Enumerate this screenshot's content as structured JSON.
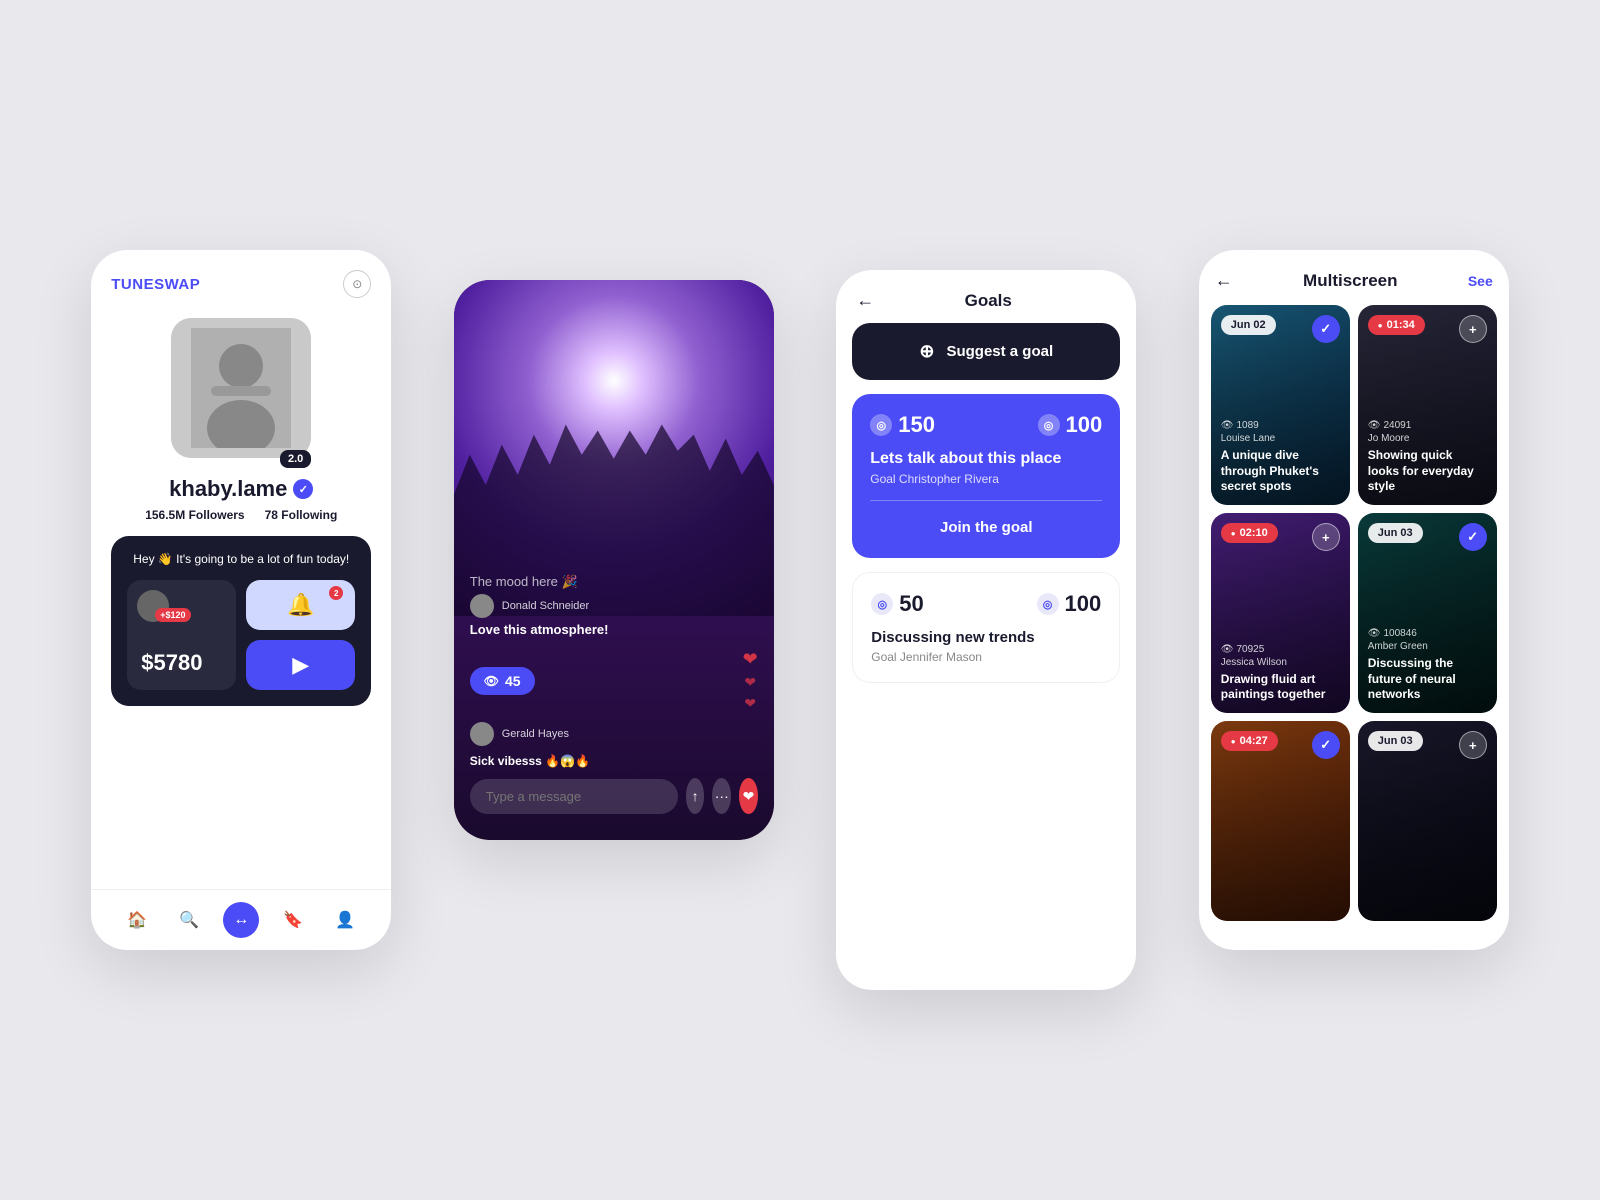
{
  "app": {
    "background": "#e8e8ed"
  },
  "profile_card": {
    "logo": {
      "tune": "TUNE",
      "swap": "SWAP"
    },
    "username": "khaby.lame",
    "verified": true,
    "rating": "2.0",
    "followers_count": "156.5M",
    "followers_label": "Followers",
    "following_count": "78",
    "following_label": "Following",
    "greeting": "Hey 👋 It's going to be a lot of fun today!",
    "balance": "$5780",
    "balance_plus": "+$120",
    "bell_badge": "2",
    "nav_items": [
      "home",
      "search",
      "swap",
      "bookmark",
      "profile"
    ],
    "settings_icon": "⊙"
  },
  "stream_card": {
    "event_title": "The mood here 🎉",
    "host_name": "Donald Schneider",
    "comment": "Love this atmosphere!",
    "viewers_count": "45",
    "second_user": "Gerald Hayes",
    "second_comment": "Sick vibesss 🔥😱🔥",
    "message_placeholder": "Type a message"
  },
  "goals_card": {
    "title": "Goals",
    "suggest_label": "Suggest a goal",
    "goal1": {
      "current": "150",
      "target": "100",
      "title": "Lets talk about this place",
      "subtitle": "Goal Christopher Rivera",
      "join_label": "Join the goal"
    },
    "goal2": {
      "current": "50",
      "target": "100",
      "title": "Discussing new trends",
      "subtitle": "Goal Jennifer Mason"
    }
  },
  "multiscreen_card": {
    "title": "Multiscreen",
    "see_label": "See",
    "items": [
      {
        "badge": "Jun 02",
        "badge_type": "date",
        "action": "check",
        "views": "1089",
        "channel": "Louise Lane",
        "description": "A unique dive through Phuket's secret spots",
        "bg": "blue"
      },
      {
        "badge": "01:34",
        "badge_type": "live",
        "action": "plus",
        "views": "24091",
        "channel": "Jo Moore",
        "description": "Showing quick looks for everyday style",
        "bg": "dark"
      },
      {
        "badge": "02:10",
        "badge_type": "live",
        "action": "plus",
        "views": "70925",
        "channel": "Jessica Wilson",
        "description": "Drawing fluid art paintings together",
        "bg": "purple"
      },
      {
        "badge": "Jun 03",
        "badge_type": "date",
        "action": "check",
        "views": "100846",
        "channel": "Amber Green",
        "description": "Discussing the future of neural networks",
        "bg": "teal"
      },
      {
        "badge": "04:27",
        "badge_type": "live",
        "action": "check",
        "views": "",
        "channel": "",
        "description": "",
        "bg": "orange"
      },
      {
        "badge": "Jun 03",
        "badge_type": "date",
        "action": "plus",
        "views": "",
        "channel": "",
        "description": "",
        "bg": "dark2"
      }
    ]
  }
}
